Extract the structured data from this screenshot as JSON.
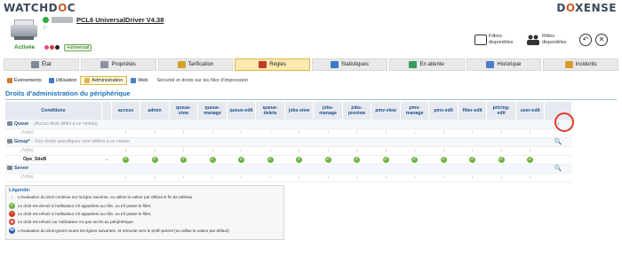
{
  "brand": {
    "left": "WATCHDOC",
    "right": "DOXENSE"
  },
  "device": {
    "name": "PCL6 UniversalDriver V4.38",
    "status": "Activée",
    "tag": "+universal",
    "status_color": "#2eaa3e"
  },
  "header": {
    "filters_label_1": "Filtres",
    "filters_label_2": "disponibles",
    "roles_label_1": "Rôles",
    "roles_label_2": "disponibles",
    "back_glyph": "↶",
    "close_glyph": "✕"
  },
  "main_tabs": [
    {
      "label": "État",
      "icon": "gear-icon",
      "color": "#7a8a99"
    },
    {
      "label": "Propriétés",
      "icon": "printer-icon",
      "color": "#8b93a0"
    },
    {
      "label": "Tarification",
      "icon": "coins-icon",
      "color": "#d4a22a"
    },
    {
      "label": "Règles",
      "icon": "rules-icon",
      "color": "#c0392b",
      "active": true
    },
    {
      "label": "Statistiques",
      "icon": "chart-icon",
      "color": "#3b7bc8"
    },
    {
      "label": "En attente",
      "icon": "clock-icon",
      "color": "#3a9a5a"
    },
    {
      "label": "Historique",
      "icon": "history-icon",
      "color": "#4c7ec9"
    },
    {
      "label": "Incidents",
      "icon": "warning-icon",
      "color": "#d89a2a"
    }
  ],
  "sub_tabs": [
    {
      "label": "Événements",
      "icon": "events-icon",
      "color": "#d47a2a"
    },
    {
      "label": "Utilisation",
      "icon": "usage-icon",
      "color": "#3b7bc8"
    },
    {
      "label": "Administration",
      "icon": "admin-icon",
      "color": "#e0b24a",
      "active": true
    },
    {
      "label": "Web",
      "icon": "web-icon",
      "color": "#4c7ec9"
    }
  ],
  "sub_description": "Sécurité et droits sur les files d'impression",
  "section_title": "Droits d'administration du périphérique",
  "table": {
    "headers": [
      "Conditions",
      "",
      "access",
      "admin",
      "queue-view",
      "queue-manage",
      "queue-edit",
      "queue-delete",
      "jobs-view",
      "jobs-manage",
      "jobs-preview",
      "pmv-view",
      "pmv-manage",
      "pmv-edit",
      "filter-edit",
      "pricing-edit",
      "user-edit",
      ""
    ],
    "header_lines": [
      [
        "Conditions"
      ],
      [
        ""
      ],
      [
        "access"
      ],
      [
        "admin"
      ],
      [
        "queue-",
        "view"
      ],
      [
        "queue-",
        "manage"
      ],
      [
        "queue-edit"
      ],
      [
        "queue-",
        "delete"
      ],
      [
        "jobs-view"
      ],
      [
        "jobs-",
        "manage"
      ],
      [
        "jobs-",
        "preview"
      ],
      [
        "pmv-view"
      ],
      [
        "pmv-",
        "manage"
      ],
      [
        "pmv-edit"
      ],
      [
        "filter-edit"
      ],
      [
        "pricing-",
        "edit"
      ],
      [
        "user-edit"
      ],
      [
        ""
      ]
    ],
    "rows": [
      {
        "type": "section",
        "label": "Queue",
        "note": "- (Aucun droit défini à ce niveau)"
      },
      {
        "type": "vide",
        "label": "(Vide)",
        "cells": "down"
      },
      {
        "type": "section",
        "label": "Group*",
        "note": "- Des droits spécifiques sont définis à ce niveau"
      },
      {
        "type": "vide",
        "label": "(Vide)",
        "cells": "down"
      },
      {
        "type": "user",
        "label": "Ope_SiteB",
        "cells": "check",
        "arrow": "→"
      },
      {
        "type": "section",
        "label": "Server",
        "note": ""
      },
      {
        "type": "vide",
        "label": "(Vide)",
        "cells": "down"
      }
    ],
    "down_glyph": "↓",
    "check_glyph": "✓",
    "zoom_glyph": "🔍",
    "highlight_glyph": "↓"
  },
  "legend": {
    "title": "Légende:",
    "items": [
      {
        "icon": "down-arrow-icon",
        "glyph": "↓",
        "color": "#888",
        "text": "L'évaluation du droit continue sur la ligne suivante, ou utilise la valeur par défaut si fin de tableau."
      },
      {
        "icon": "allowed-icon",
        "glyph": "✓",
        "color": "#6cb43f",
        "text": "Le droit est donné à l'utilisateur s'il appartient au rôle, ou s'il passe le filtre."
      },
      {
        "icon": "denied-icon",
        "glyph": "−",
        "color": "#d03a2a",
        "text": "Le droit est refusé à l'utilisateur s'il appartient au rôle, ou s'il passe le filtre."
      },
      {
        "icon": "blocked-icon",
        "glyph": "⊘",
        "color": "#d03a2a",
        "text": "Le droit est refusé car l'utilisateur n'a pas accès au périphérique."
      },
      {
        "icon": "return-icon",
        "glyph": "⇆",
        "color": "#2a5fb0",
        "text": "L'évaluation du droit ignore toutes les lignes suivantes, et remonte vers le profil parent (ou utilise la valeur par défaut)"
      }
    ]
  }
}
